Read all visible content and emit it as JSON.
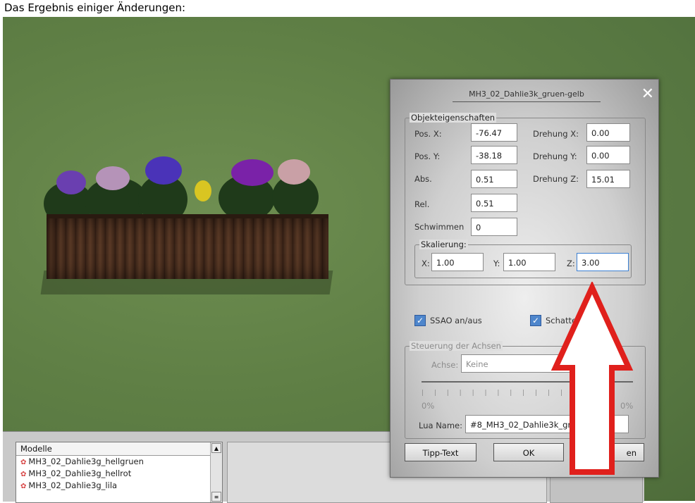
{
  "caption": "Das Ergebnis einiger Änderungen:",
  "dialog": {
    "title": "MH3_02_Dahlie3k_gruen-gelb",
    "close_icon": "close-icon",
    "group_props": "Objekteigenschaften",
    "pos_x_label": "Pos. X:",
    "pos_x": "-76.47",
    "pos_y_label": "Pos. Y:",
    "pos_y": "-38.18",
    "abs_label": "Abs.",
    "abs": "0.51",
    "rel_label": "Rel.",
    "rel": "0.51",
    "schwimmen_label": "Schwimmen",
    "schwimmen": "0",
    "rot_x_label": "Drehung X:",
    "rot_x": "0.00",
    "rot_y_label": "Drehung Y:",
    "rot_y": "0.00",
    "rot_z_label": "Drehung Z:",
    "rot_z": "15.01",
    "group_scale": "Skalierung:",
    "sx_label": "X:",
    "sx": "1.00",
    "sy_label": "Y:",
    "sy": "1.00",
    "sz_label": "Z:",
    "sz": "3.00",
    "ssao_label": "SSAO an/aus",
    "ssao_checked": true,
    "schatten_label": "Schatten",
    "schatten_checked": true,
    "group_axes": "Steuerung der Achsen",
    "achse_label": "Achse:",
    "achse_value": "Keine",
    "slider_min": "0%",
    "slider_max": "0%",
    "lua_label": "Lua Name:",
    "lua_value": "#8_MH3_02_Dahlie3k_gr",
    "tipp_button": "Tipp-Text",
    "ok_button": "OK",
    "cancel_button": "en"
  },
  "model_list": {
    "header": "Modelle",
    "items": [
      "MH3_02_Dahlie3g_hellgruen",
      "MH3_02_Dahlie3g_hellrot",
      "MH3_02_Dahlie3g_lila"
    ]
  },
  "colors": {
    "grass": "#5f7f45",
    "arrow_red": "#e0201c",
    "check_blue": "#4e86cc"
  }
}
